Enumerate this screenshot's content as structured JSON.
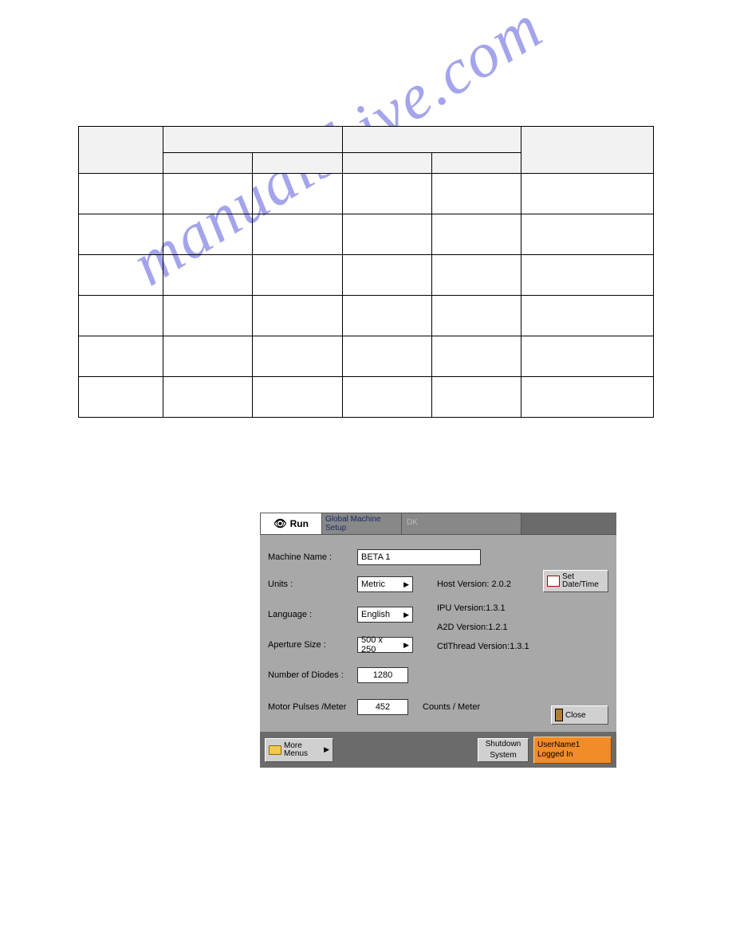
{
  "watermark": "manualshive.com",
  "table": {
    "header_cell_count_row1": 4,
    "header_cell_count_row2": 6,
    "body_rows": 6
  },
  "dialog": {
    "tabs": {
      "run": "Run",
      "mid_line1": "Global Machine",
      "mid_line2": "Setup",
      "dk": "DK"
    },
    "labels": {
      "machine_name": "Machine Name :",
      "units": "Units :",
      "language": "Language :",
      "aperture": "Aperture Size :",
      "diodes": "Number of Diodes :",
      "motor": "Motor Pulses /Meter",
      "counts_meter": "Counts / Meter"
    },
    "values": {
      "machine_name": "BETA 1",
      "units": "Metric",
      "language": "English",
      "aperture": "500 x 250",
      "diodes": "1280",
      "motor": "452"
    },
    "versions": {
      "host": "Host Version: 2.0.2",
      "ipu": "IPU Version:1.3.1",
      "a2d": "A2D Version:1.2.1",
      "ctl": "CtlThread Version:1.3.1"
    },
    "buttons": {
      "set_datetime_l1": "Set",
      "set_datetime_l2": "Date/Time",
      "close": "Close",
      "more_l1": "More",
      "more_l2": "Menus",
      "shutdown_l1": "Shutdown",
      "shutdown_l2": "System"
    },
    "status": {
      "l1": "UserName1",
      "l2": "Logged In"
    }
  }
}
